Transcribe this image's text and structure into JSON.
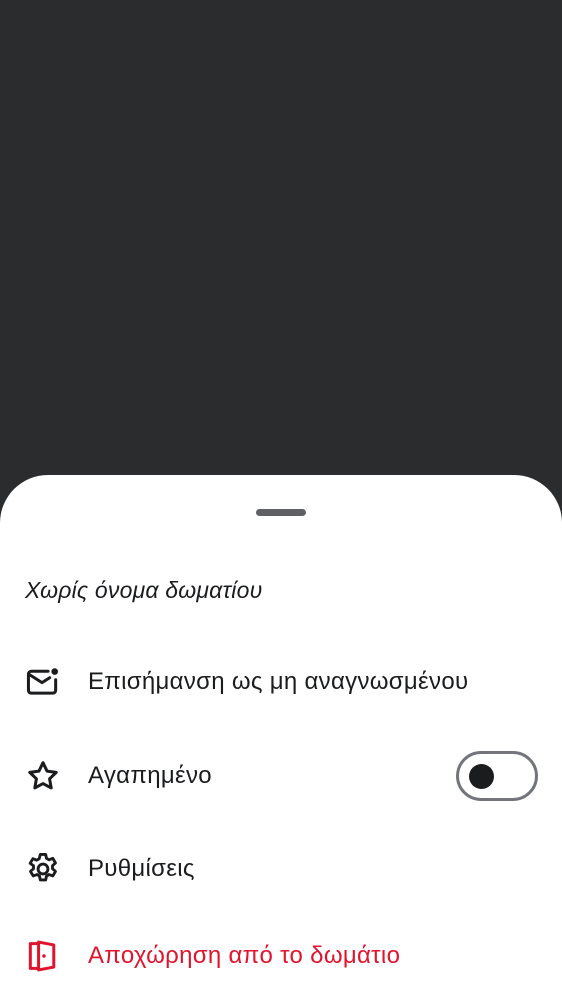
{
  "sheet": {
    "title": "Χωρίς όνομα δωματίου",
    "items": [
      {
        "icon": "mail-unread-icon",
        "label": "Επισήμανση ως μη αναγνωσμένου"
      },
      {
        "icon": "star-icon",
        "label": "Αγαπημένο",
        "toggle_on": false
      },
      {
        "icon": "gear-icon",
        "label": "Ρυθμίσεις"
      },
      {
        "icon": "leave-door-icon",
        "label": "Αποχώρηση από το δωμάτιο",
        "color": "#e0142c"
      }
    ]
  },
  "colors": {
    "scrim": "#2b2c2e",
    "sheet": "#ffffff",
    "text": "#1b1c1e",
    "danger": "#e0142c"
  }
}
